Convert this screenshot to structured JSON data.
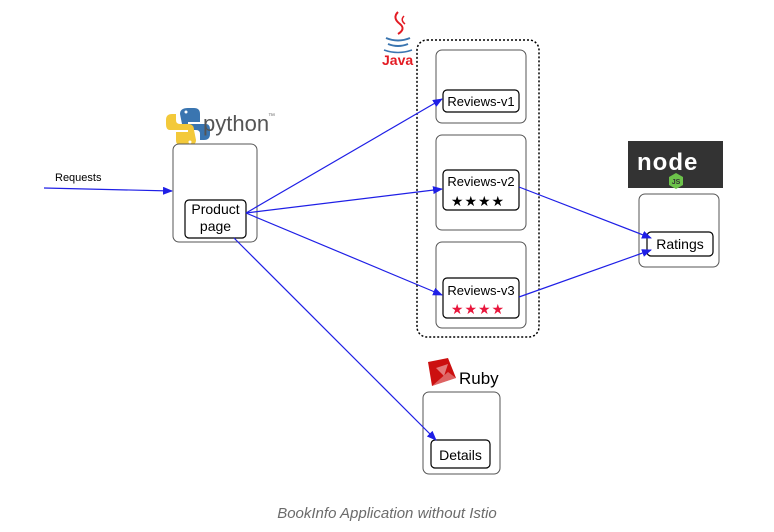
{
  "diagram": {
    "requests_label": "Requests",
    "caption": "BookInfo Application without Istio",
    "colors": {
      "arrow": "#1f1fe6",
      "star_black": "#000000",
      "star_red": "#e8163c",
      "box_border": "#555555",
      "node_bg": "#333333",
      "node_green": "#6cc24a",
      "ruby_red": "#cc1010",
      "java_red": "#e31b23",
      "java_blue": "#3a75b0"
    },
    "logos": {
      "python": {
        "icon": "python-logo-icon",
        "text": "python",
        "tm": "™"
      },
      "java": {
        "icon": "java-logo-icon",
        "text": "Java"
      },
      "node": {
        "icon": "node-logo-icon",
        "text": "node",
        "badge": "JS"
      },
      "ruby": {
        "icon": "ruby-logo-icon",
        "text": "Ruby"
      }
    },
    "services": {
      "productpage": {
        "label_line1": "Product",
        "label_line2": "page"
      },
      "reviews_v1": {
        "label": "Reviews-v1"
      },
      "reviews_v2": {
        "label": "Reviews-v2",
        "stars": "★★★★",
        "star_color": "black"
      },
      "reviews_v3": {
        "label": "Reviews-v3",
        "stars": "★★★★",
        "star_color": "red"
      },
      "ratings": {
        "label": "Ratings"
      },
      "details": {
        "label": "Details"
      }
    }
  }
}
